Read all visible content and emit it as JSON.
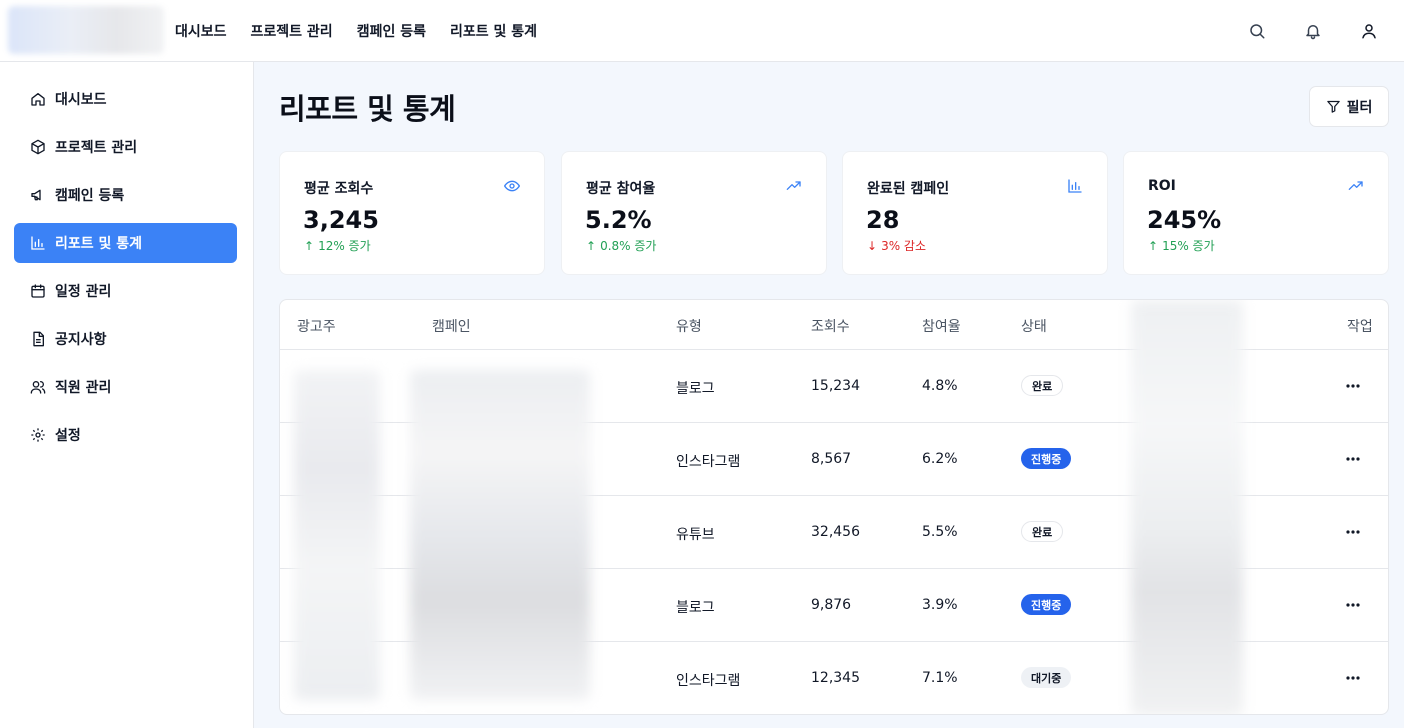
{
  "topnav": {
    "items": [
      "대시보드",
      "프로젝트 관리",
      "캠페인 등록",
      "리포트 및 통계"
    ],
    "icons": [
      "search-icon",
      "bell-icon",
      "user-icon"
    ]
  },
  "sidebar": {
    "items": [
      {
        "label": "대시보드",
        "icon": "home-icon",
        "active": false
      },
      {
        "label": "프로젝트 관리",
        "icon": "box-icon",
        "active": false
      },
      {
        "label": "캠페인 등록",
        "icon": "megaphone-icon",
        "active": false
      },
      {
        "label": "리포트 및 통계",
        "icon": "bar-chart-icon",
        "active": true
      },
      {
        "label": "일정 관리",
        "icon": "calendar-icon",
        "active": false
      },
      {
        "label": "공지사항",
        "icon": "document-icon",
        "active": false
      },
      {
        "label": "직원 관리",
        "icon": "users-icon",
        "active": false
      },
      {
        "label": "설정",
        "icon": "gear-icon",
        "active": false
      }
    ],
    "active_color": "#3b82f6"
  },
  "page": {
    "title": "리포트 및 통계",
    "filter_label": "필터"
  },
  "stats": [
    {
      "label": "평균 조회수",
      "value": "3,245",
      "change": "12% 증가",
      "direction": "up",
      "icon": "eye-icon"
    },
    {
      "label": "평균 참여율",
      "value": "5.2%",
      "change": "0.8% 증가",
      "direction": "up",
      "icon": "trending-up-icon"
    },
    {
      "label": "완료된 캠페인",
      "value": "28",
      "change": "3% 감소",
      "direction": "down",
      "icon": "bar-chart-icon"
    },
    {
      "label": "ROI",
      "value": "245%",
      "change": "15% 증가",
      "direction": "up",
      "icon": "trending-up-icon"
    }
  ],
  "table": {
    "headers": [
      "광고주",
      "캠페인",
      "유형",
      "조회수",
      "참여율",
      "상태",
      "작업"
    ],
    "rows": [
      {
        "type": "블로그",
        "views": "15,234",
        "engagement": "4.8%",
        "status": "완료",
        "status_kind": "done"
      },
      {
        "type": "인스타그램",
        "views": "8,567",
        "engagement": "6.2%",
        "status": "진행중",
        "status_kind": "progress"
      },
      {
        "type": "유튜브",
        "views": "32,456",
        "engagement": "5.5%",
        "status": "완료",
        "status_kind": "done"
      },
      {
        "type": "블로그",
        "views": "9,876",
        "engagement": "3.9%",
        "status": "진행중",
        "status_kind": "progress"
      },
      {
        "type": "인스타그램",
        "views": "12,345",
        "engagement": "7.1%",
        "status": "대기중",
        "status_kind": "wait"
      }
    ]
  },
  "colors": {
    "up": "#22a055",
    "down": "#dc2626",
    "badge_progress": "#2563eb",
    "accent_icon": "#3b82f6"
  }
}
